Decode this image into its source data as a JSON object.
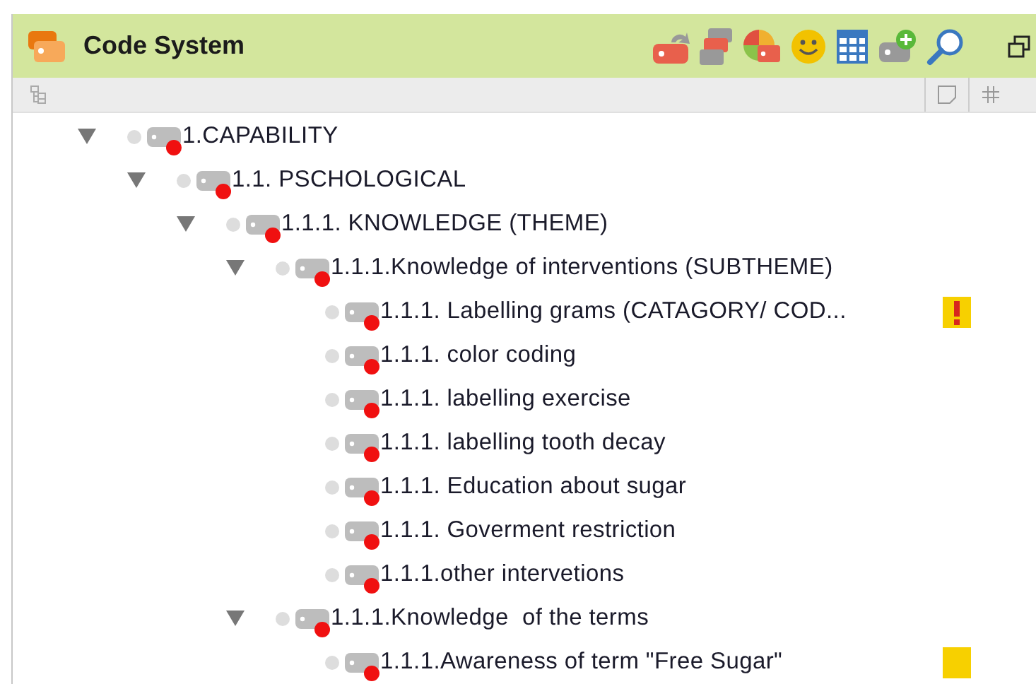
{
  "panel": {
    "title": "Code System"
  },
  "tree": [
    {
      "label": "1.CAPABILITY",
      "expanded": true,
      "children": [
        {
          "label": "1.1. PSCHOLOGICAL",
          "expanded": true,
          "children": [
            {
              "label": "1.1.1. KNOWLEDGE (THEME)",
              "expanded": true,
              "children": [
                {
                  "label": "1.1.1.Knowledge of interventions (SUBTHEME)",
                  "expanded": true,
                  "children": [
                    {
                      "label": "1.1.1. Labelling grams (CATAGORY/ COD...",
                      "memo": {
                        "kind": "important"
                      }
                    },
                    {
                      "label": "1.1.1. color coding"
                    },
                    {
                      "label": "1.1.1. labelling exercise"
                    },
                    {
                      "label": "1.1.1. labelling tooth decay"
                    },
                    {
                      "label": "1.1.1. Education about sugar"
                    },
                    {
                      "label": "1.1.1. Goverment restriction"
                    },
                    {
                      "label": "1.1.1.other intervetions"
                    }
                  ]
                },
                {
                  "label": "1.1.1.Knowledge  of the terms",
                  "expanded": true,
                  "children": [
                    {
                      "label": "1.1.1.Awareness of term \"Free Sugar\"",
                      "memo": {
                        "kind": "plain"
                      }
                    }
                  ]
                }
              ]
            }
          ]
        }
      ]
    }
  ]
}
